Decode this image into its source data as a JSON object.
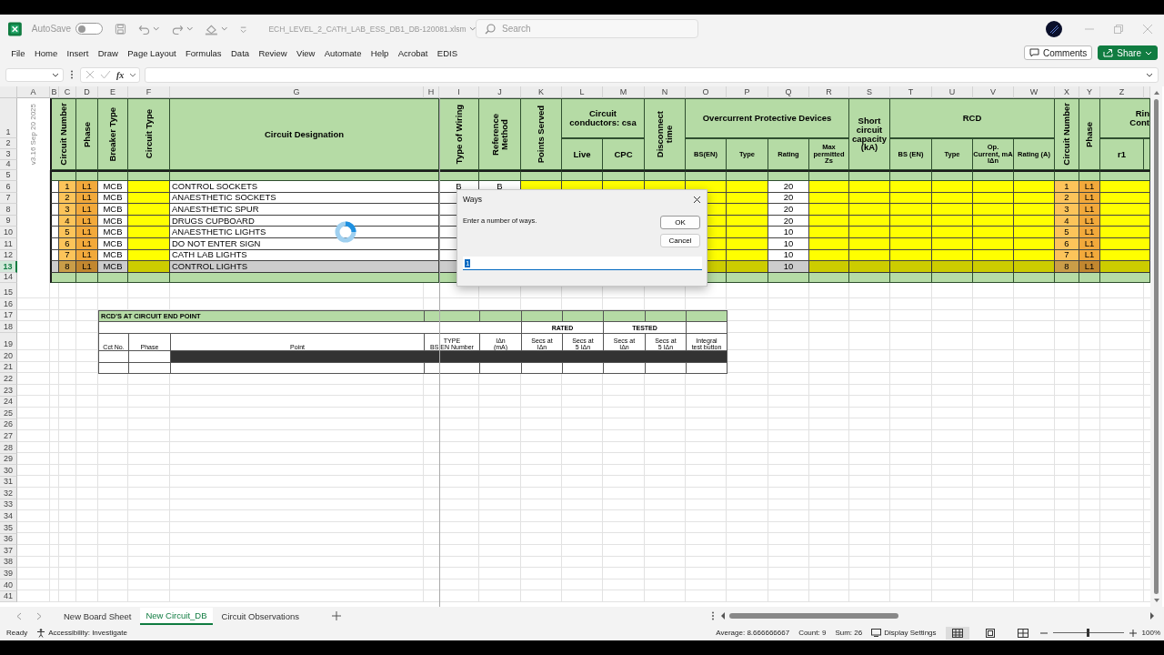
{
  "title_bar": {
    "autosave_label": "AutoSave",
    "autosave_on": false,
    "filename": "ECH_LEVEL_2_CATH_LAB_ESS_DB1_DB-120081.xlsm",
    "search_placeholder": "Search"
  },
  "ribbon_tabs": [
    {
      "label": "File"
    },
    {
      "label": "Home"
    },
    {
      "label": "Insert"
    },
    {
      "label": "Draw"
    },
    {
      "label": "Page Layout"
    },
    {
      "label": "Formulas"
    },
    {
      "label": "Data"
    },
    {
      "label": "Review"
    },
    {
      "label": "View"
    },
    {
      "label": "Automate"
    },
    {
      "label": "Help"
    },
    {
      "label": "Acrobat"
    },
    {
      "label": "EDIS"
    }
  ],
  "ribbon_actions": [
    {
      "label": "Comments",
      "kind": "comments"
    },
    {
      "label": "Share",
      "kind": "share"
    }
  ],
  "formula_bar": {
    "function_label": "fx"
  },
  "sheet": {
    "columns": [
      "A",
      "B",
      "C",
      "D",
      "E",
      "F",
      "G",
      "H",
      "I",
      "J",
      "K",
      "L",
      "M",
      "N",
      "O",
      "P",
      "Q",
      "R",
      "S",
      "T",
      "U",
      "V",
      "W",
      "X",
      "Y",
      "Z"
    ],
    "rows": [
      {
        "label": "1",
        "selected": false
      },
      {
        "label": "2",
        "selected": false
      },
      {
        "label": "3",
        "selected": false
      },
      {
        "label": "4",
        "selected": false
      },
      {
        "label": "5",
        "selected": false
      },
      {
        "label": "6",
        "selected": false
      },
      {
        "label": "7",
        "selected": false
      },
      {
        "label": "8",
        "selected": false
      },
      {
        "label": "9",
        "selected": false
      },
      {
        "label": "10",
        "selected": false
      },
      {
        "label": "11",
        "selected": false
      },
      {
        "label": "12",
        "selected": false
      },
      {
        "label": "13",
        "selected": true
      },
      {
        "label": "14",
        "selected": false
      },
      {
        "label": "15",
        "selected": false
      },
      {
        "label": "16",
        "selected": false
      },
      {
        "label": "17",
        "selected": false
      },
      {
        "label": "18",
        "selected": false
      },
      {
        "label": "19",
        "selected": false
      },
      {
        "label": "20",
        "selected": false
      },
      {
        "label": "21",
        "selected": false
      },
      {
        "label": "22",
        "selected": false
      },
      {
        "label": "23",
        "selected": false
      },
      {
        "label": "24",
        "selected": false
      },
      {
        "label": "25",
        "selected": false
      },
      {
        "label": "26",
        "selected": false
      },
      {
        "label": "27",
        "selected": false
      },
      {
        "label": "28",
        "selected": false
      },
      {
        "label": "29",
        "selected": false
      },
      {
        "label": "30",
        "selected": false
      },
      {
        "label": "31",
        "selected": false
      },
      {
        "label": "32",
        "selected": false
      },
      {
        "label": "33",
        "selected": false
      },
      {
        "label": "34",
        "selected": false
      },
      {
        "label": "35",
        "selected": false
      },
      {
        "label": "36",
        "selected": false
      },
      {
        "label": "37",
        "selected": false
      },
      {
        "label": "38",
        "selected": false
      },
      {
        "label": "39",
        "selected": false
      },
      {
        "label": "40",
        "selected": false
      },
      {
        "label": "41",
        "selected": false
      }
    ],
    "version_note": "v3.16 Sep 20 2025",
    "header_cells": [
      "Circuit Number",
      "Phase",
      "Breaker Type",
      "Circuit Type",
      "Circuit Designation",
      "Type of Wiring",
      "Reference\nMethod",
      "Points Served",
      "Circuit\nconductors: csa",
      "Live",
      "CPC",
      "Disconnect\ntime",
      "Overcurrent Protective Devices",
      "BS(EN)",
      "Type",
      "Rating",
      "Max\npermitted\nZs",
      "Short\ncircuit\ncapacity\n(kA)",
      "RCD",
      "BS (EN)",
      "Type",
      "Op.\nCurrent, mA\nIΔn",
      "Rating (A)",
      "Circuit Number",
      "Phase",
      "Rin\nCont",
      "r1"
    ],
    "circuits": [
      {
        "number": "1",
        "phase": "L1",
        "breaker": "MCB",
        "designation": "CONTROL SOCKETS",
        "wiring": "B",
        "method": "B",
        "rating": "20",
        "end_number": "1",
        "end_phase": "L1",
        "selected": false
      },
      {
        "number": "2",
        "phase": "L1",
        "breaker": "MCB",
        "designation": "ANAESTHETIC SOCKETS",
        "rating": "20",
        "end_number": "2",
        "end_phase": "L1",
        "selected": false
      },
      {
        "number": "3",
        "phase": "L1",
        "breaker": "MCB",
        "designation": "ANAESTHETIC SPUR",
        "rating": "20",
        "end_number": "3",
        "end_phase": "L1",
        "selected": false
      },
      {
        "number": "4",
        "phase": "L1",
        "breaker": "MCB",
        "designation": "DRUGS CUPBOARD",
        "rating": "20",
        "end_number": "4",
        "end_phase": "L1",
        "selected": false
      },
      {
        "number": "5",
        "phase": "L1",
        "breaker": "MCB",
        "designation": "ANAESTHETIC LIGHTS",
        "rating": "10",
        "end_number": "5",
        "end_phase": "L1",
        "selected": false
      },
      {
        "number": "6",
        "phase": "L1",
        "breaker": "MCB",
        "designation": "DO NOT ENTER SIGN",
        "rating": "10",
        "end_number": "6",
        "end_phase": "L1",
        "selected": false
      },
      {
        "number": "7",
        "phase": "L1",
        "breaker": "MCB",
        "designation": "CATH LAB LIGHTS",
        "rating": "10",
        "end_number": "7",
        "end_phase": "L1",
        "selected": false
      },
      {
        "number": "8",
        "phase": "L1",
        "breaker": "MCB",
        "designation": "CONTROL LIGHTS",
        "rating": "10",
        "end_number": "8",
        "end_phase": "L1",
        "selected": true
      }
    ],
    "rcd_table": {
      "title": "RCD'S AT CIRCUIT END POINT",
      "group_headers": [
        "RATED",
        "TESTED"
      ],
      "columns": [
        "Cct No.",
        "Phase",
        "Point",
        "TYPE\nBS EN Number",
        "IΔn\n(mA)",
        "Secs at\nIΔn",
        "Secs at\n5 IΔn",
        "Secs at\nIΔn",
        "Secs at\n5 IΔn",
        "Integral\ntest button"
      ]
    }
  },
  "dialog": {
    "title": "Ways",
    "message": "Enter a number of ways.",
    "buttons": [
      {
        "label": "OK",
        "kind": "default"
      },
      {
        "label": "Cancel",
        "kind": "cancel"
      }
    ],
    "value": "1"
  },
  "sheet_tabs": [
    {
      "label": "New Board Sheet",
      "selected": false
    },
    {
      "label": "New Circuit_DB",
      "selected": true
    },
    {
      "label": "Circuit Observations",
      "selected": false
    }
  ],
  "status_bar": {
    "mode": "Ready",
    "accessibility": "Accessibility: Investigate",
    "average": "Average: 8.666666667",
    "count": "Count: 9",
    "sum": "Sum: 26",
    "display_settings": "Display Settings",
    "view_modes": [
      {
        "selected": true
      },
      {
        "selected": false
      },
      {
        "selected": false
      }
    ],
    "zoom_slider": {
      "level": 0.5
    },
    "zoom": "100%"
  }
}
